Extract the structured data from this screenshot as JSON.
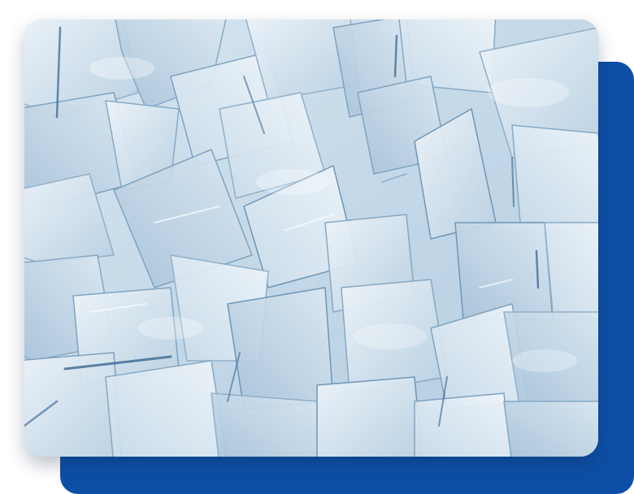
{
  "colors": {
    "background": "#ffffff",
    "back_card": "#0d4fa6",
    "ice_light": "#e6eff6",
    "ice_mid": "#bcd3e4",
    "ice_dark": "#7fa3c1",
    "ice_edge": "#4f7ea6"
  },
  "image": {
    "subject": "ice-cubes-photo"
  }
}
